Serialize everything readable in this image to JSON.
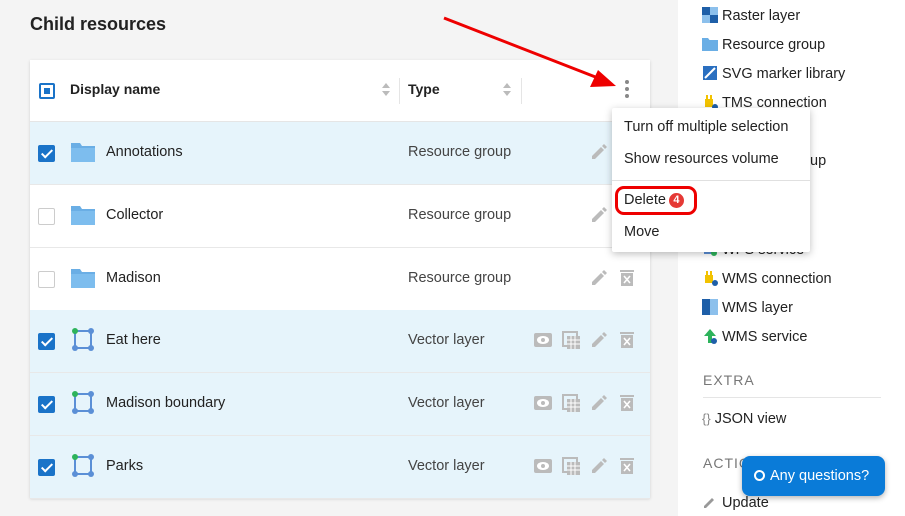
{
  "page": {
    "title": "Child resources"
  },
  "table": {
    "col_name": "Display name",
    "col_type": "Type",
    "rows": [
      {
        "name": "Annotations",
        "type": "Resource group",
        "selected": true,
        "icon": "folder-icon"
      },
      {
        "name": "Collector",
        "type": "Resource group",
        "selected": false,
        "icon": "folder-icon"
      },
      {
        "name": "Madison",
        "type": "Resource group",
        "selected": false,
        "icon": "folder-icon"
      },
      {
        "name": "Eat here",
        "type": "Vector layer",
        "selected": true,
        "icon": "vector-layer-icon"
      },
      {
        "name": "Madison boundary",
        "type": "Vector layer",
        "selected": true,
        "icon": "vector-layer-icon"
      },
      {
        "name": "Parks",
        "type": "Vector layer",
        "selected": true,
        "icon": "vector-layer-icon"
      }
    ]
  },
  "menu": {
    "items": [
      "Turn off multiple selection",
      "Show resources volume",
      "Delete",
      "Move"
    ],
    "delete_badge": "4"
  },
  "sidebar": {
    "create_items": [
      "Raster layer",
      "Resource group",
      "SVG marker library",
      "TMS connection",
      "up",
      "WFS service",
      "WMS connection",
      "WMS layer",
      "WMS service"
    ],
    "extra_heading": "EXTRA",
    "extra_items": [
      "JSON view"
    ],
    "actions_heading": "ACTIO",
    "actions_items": [
      "Update"
    ]
  },
  "help": {
    "label": "Any questions?"
  },
  "colors": {
    "accent": "#1a73c8",
    "selected_row": "#e6f4fb",
    "annotation_red": "#e00000",
    "help_button": "#0a7bd8"
  }
}
